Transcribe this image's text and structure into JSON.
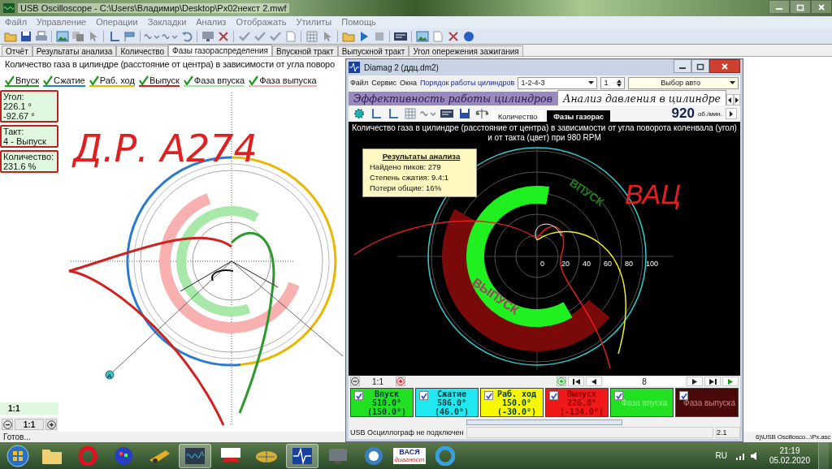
{
  "window": {
    "title": "USB Oscilloscope - C:\\Users\\Владимир\\Desktop\\Рх02некст 2.mwf"
  },
  "menu": [
    "Файл",
    "Управление",
    "Операции",
    "Закладки",
    "Анализ",
    "Отображать",
    "Утилиты",
    "Помощь"
  ],
  "tabs": [
    {
      "label": "Отчёт",
      "selected": false
    },
    {
      "label": "Результаты анализа",
      "selected": false
    },
    {
      "label": "Количество",
      "selected": false
    },
    {
      "label": "Фазы газораспределения",
      "selected": true
    },
    {
      "label": "Впускной тракт",
      "selected": false
    },
    {
      "label": "Выпускной тракт",
      "selected": false
    },
    {
      "label": "Угол опережения зажигания",
      "selected": false
    }
  ],
  "heading": "Количество газа в цилиндре (расстояние от центра) в зависимости от угла поворо",
  "legend": [
    {
      "label": "Впуск",
      "checked": true,
      "color": "#2a9a2a"
    },
    {
      "label": "Сжатие",
      "checked": true,
      "color": "#2a7ad0"
    },
    {
      "label": "Раб. ход",
      "checked": true,
      "color": "#e8b800"
    },
    {
      "label": "Выпуск",
      "checked": true,
      "color": "#d02020"
    },
    {
      "label": "Фаза впуска",
      "checked": true,
      "color": "#a8e0a8"
    },
    {
      "label": "Фаза выпуска",
      "checked": true,
      "color": "#f0b0b0"
    }
  ],
  "readouts": [
    {
      "label": "Угол:",
      "values": [
        "226.1 °",
        "-92.67 °"
      ]
    },
    {
      "label": "Такт:",
      "values": [
        "4 - Выпуск"
      ]
    },
    {
      "label": "Количество:",
      "values": [
        "231.6 %"
      ]
    }
  ],
  "scale": "1:1",
  "zoom": "1:1",
  "handwriting": "Д.Р. А274",
  "marker": "A",
  "diamag": {
    "title": "Diamag 2 (ддц.dm2)",
    "menu": [
      "Файл",
      "Сервис",
      "Окна",
      "Порядок работы цилиндров"
    ],
    "order": "1-2-4-3",
    "cylinder": "1",
    "car": "Выбор авто",
    "tabs": [
      {
        "label": "Эффективность работы цилиндров",
        "selected": false
      },
      {
        "label": "Анализ давления в цилиндре",
        "selected": true
      }
    ],
    "subtabs": [
      {
        "label": "Количество",
        "selected": false
      },
      {
        "label": "Фазы газорас",
        "selected": true
      }
    ],
    "rpm": "920",
    "rpm_unit": "об./мин.",
    "chart_title": "Количество газа в цилиндре (расстояние от центра) в зависимости от угла поворота коленвала (угол) и от такта (цвет) при 980 RPM",
    "results": {
      "title": "Результаты анализа",
      "lines": [
        "Найдено пиков: 279",
        "Степень сжатия: 9.4:1",
        "Потери общие: 16%"
      ]
    },
    "handwriting": "ВАЦ",
    "ring_labels": [
      "ВПУСК",
      "ВЫПУСК"
    ],
    "radial_labels": [
      "0",
      "20",
      "40",
      "60",
      "80",
      "100"
    ],
    "zoom": "1:1",
    "frame": "8",
    "cards": [
      {
        "name": "Впуск",
        "angle": "510.0°",
        "relative": "(150.0°)",
        "checked": true,
        "color": "#22e022"
      },
      {
        "name": "Сжатие",
        "angle": "586.0°",
        "relative": "(46.0°)",
        "checked": true,
        "color": "#20e8f0"
      },
      {
        "name": "Раб. ход",
        "angle": "150.0°",
        "relative": "(-30.0°)",
        "checked": true,
        "color": "#f8f800"
      },
      {
        "name": "Выпуск",
        "angle": "226.0°",
        "relative": "(-134.0°)",
        "checked": true,
        "color": "#f01818"
      },
      {
        "name": "Фаза впуска",
        "checked": true,
        "color": "#22e022"
      },
      {
        "name": "Фаза выпуска",
        "checked": true,
        "color": "#4a0808"
      }
    ],
    "status": "USB Осциллограф не подключен",
    "version": "2.1"
  },
  "status_bar": {
    "text": "Готов...",
    "path": "6)\\USB Oscillosco...\\Px.asc"
  },
  "taskbar": {
    "vasya": "ВАСЯ",
    "vasya_sub": "диагност",
    "language": "RU",
    "time": "21:19",
    "date": "05.02.2020"
  }
}
